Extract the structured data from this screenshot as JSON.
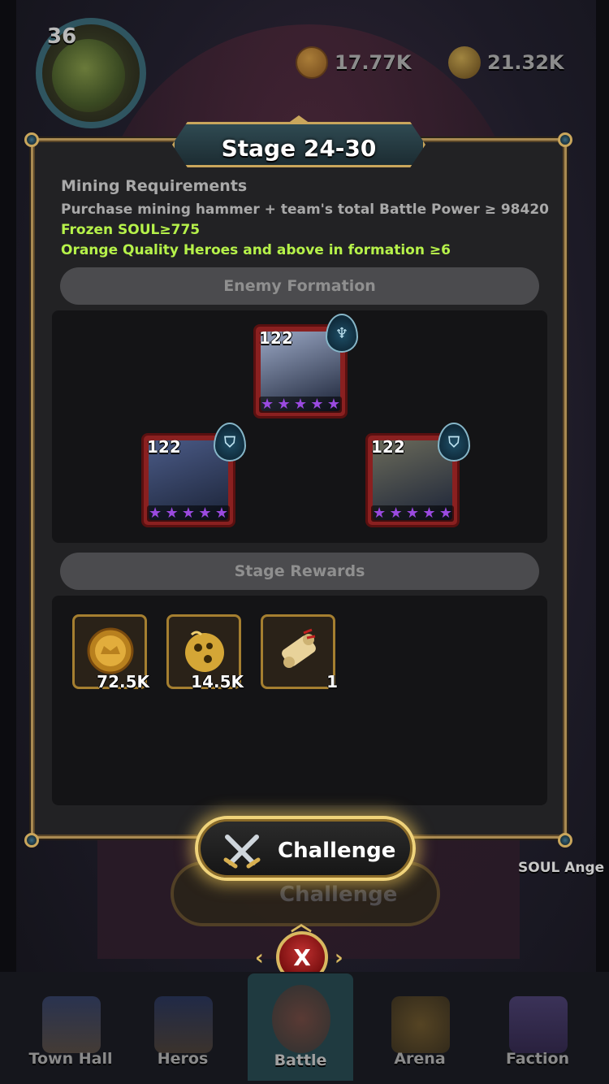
{
  "hud": {
    "player_level": "36",
    "gold": "17.77K",
    "soul": "21.32K"
  },
  "modal": {
    "title": "Stage 24-30",
    "requirements": {
      "title": "Mining Requirements",
      "line1": "Purchase mining hammer + team's total Battle Power ≥ 98420",
      "line2": "Frozen SOUL≥775",
      "line3": "Orange Quality Heroes and above in formation ≥6"
    },
    "enemy_formation": {
      "header": "Enemy Formation",
      "heroes": [
        {
          "level": "122",
          "stars": 5,
          "faction_icon": "trident-icon",
          "art_color": "#9aa7c4"
        },
        {
          "level": "122",
          "stars": 5,
          "faction_icon": "shield-icon",
          "art_color": "#4a5a86"
        },
        {
          "level": "122",
          "stars": 5,
          "faction_icon": "shield-icon",
          "art_color": "#6a6a5a"
        }
      ]
    },
    "stage_rewards": {
      "header": "Stage Rewards",
      "items": [
        {
          "name": "gold-coin-icon",
          "qty": "72.5K"
        },
        {
          "name": "soul-orb-icon",
          "qty": "14.5K"
        },
        {
          "name": "scroll-icon",
          "qty": "1"
        }
      ]
    },
    "challenge_label": "Challenge",
    "close_label": "X"
  },
  "background": {
    "challenge_ghost_label": "Challenge",
    "soul_angel_label": "SOUL Ange"
  },
  "nav": {
    "items": [
      {
        "label": "Town Hall",
        "icon": "castle-icon"
      },
      {
        "label": "Heros",
        "icon": "helmet-icon"
      },
      {
        "label": "Battle",
        "icon": "skull-shield-icon"
      },
      {
        "label": "Arena",
        "icon": "arena-crest-icon"
      },
      {
        "label": "Faction",
        "icon": "banner-icon"
      }
    ]
  },
  "colors": {
    "accent_gold": "#c9a65c",
    "requirement_green": "#b6f24a",
    "hero_frame_red": "#8a2020",
    "star_purple": "#9a4ae0"
  }
}
